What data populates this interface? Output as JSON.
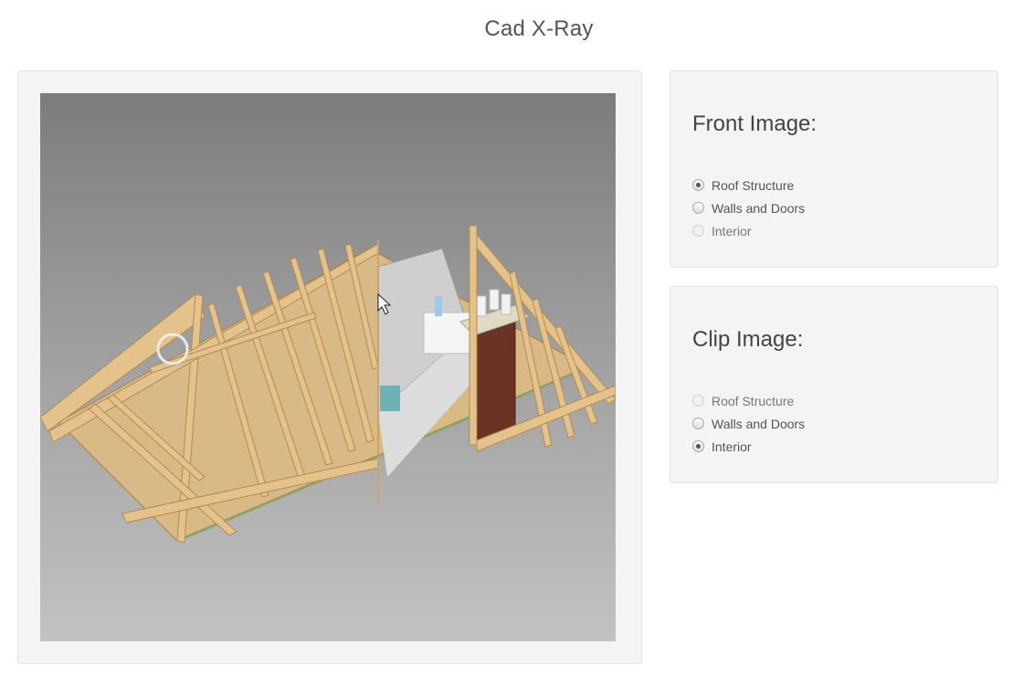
{
  "page": {
    "title": "Cad X-Ray"
  },
  "front_image": {
    "heading": "Front Image:",
    "options": [
      {
        "label": "Roof Structure",
        "checked": true,
        "disabled": false
      },
      {
        "label": "Walls and Doors",
        "checked": false,
        "disabled": false
      },
      {
        "label": "Interior",
        "checked": false,
        "disabled": true
      }
    ]
  },
  "clip_image": {
    "heading": "Clip Image:",
    "options": [
      {
        "label": "Roof Structure",
        "checked": false,
        "disabled": true
      },
      {
        "label": "Walls and Doors",
        "checked": false,
        "disabled": false
      },
      {
        "label": "Interior",
        "checked": true,
        "disabled": false
      }
    ]
  },
  "viewer": {
    "colors": {
      "timber": "#e2bf86",
      "timber_edge": "#b48a50",
      "brick": "#6b3326",
      "floor": "#d6b583"
    }
  }
}
